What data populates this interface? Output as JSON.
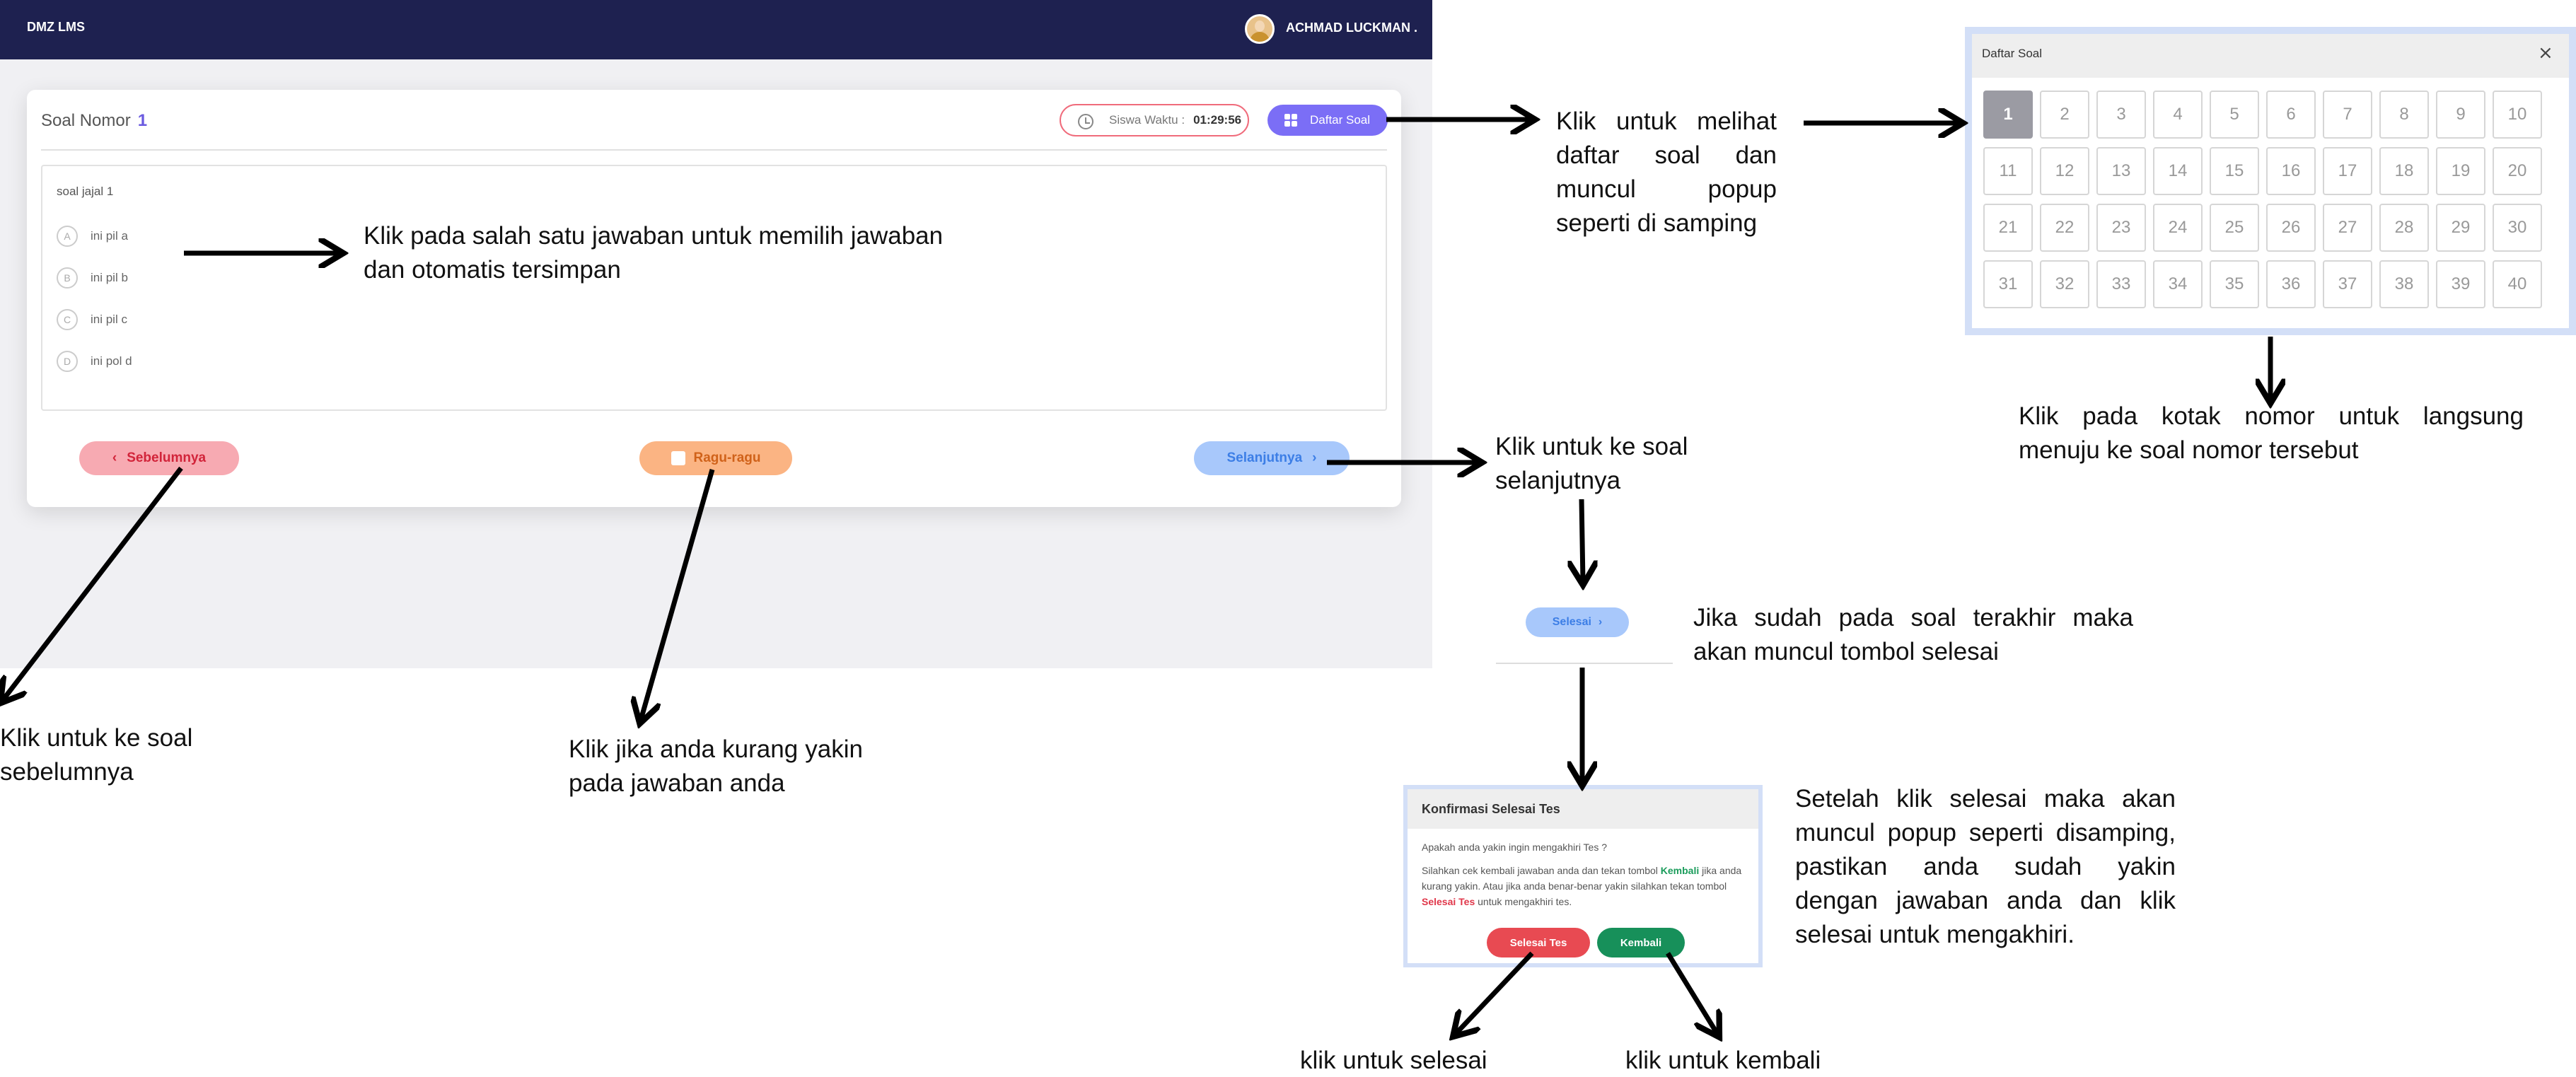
{
  "app": {
    "brand": "DMZ LMS",
    "username": "ACHMAD LUCKMAN ."
  },
  "exam": {
    "title_label": "Soal Nomor",
    "number": "1",
    "timer_label": "Siswa Waktu :",
    "timer_value": "01:29:56",
    "daftar_button": "Daftar Soal",
    "question": "soal jajal 1",
    "options": [
      {
        "letter": "A",
        "text": "ini pil a"
      },
      {
        "letter": "B",
        "text": "ini pil b"
      },
      {
        "letter": "C",
        "text": "ini pil c"
      },
      {
        "letter": "D",
        "text": "ini pol d"
      }
    ],
    "prev_button": "Sebelumnya",
    "ragu_button": "Ragu-ragu",
    "next_button": "Selanjutnya"
  },
  "daftar_popup": {
    "title": "Daftar Soal",
    "close": "×",
    "active": 1,
    "numbers": [
      "1",
      "2",
      "3",
      "4",
      "5",
      "6",
      "7",
      "8",
      "9",
      "10",
      "11",
      "12",
      "13",
      "14",
      "15",
      "16",
      "17",
      "18",
      "19",
      "20",
      "21",
      "22",
      "23",
      "24",
      "25",
      "26",
      "27",
      "28",
      "29",
      "30",
      "31",
      "32",
      "33",
      "34",
      "35",
      "36",
      "37",
      "38",
      "39",
      "40"
    ]
  },
  "selesai_button": "Selesai",
  "konfirmasi": {
    "title": "Konfirmasi Selesai Tes",
    "question": "Apakah anda yakin ingin mengakhiri Tes ?",
    "body_1": "Silahkan cek kembali jawaban anda dan tekan tombol ",
    "body_kembali": "Kembali",
    "body_2": " jika anda kurang yakin. Atau jika anda benar-benar yakin silahkan tekan tombol ",
    "body_selesai": "Selesai Tes",
    "body_3": " untuk mengakhiri tes.",
    "selesai_tes_button": "Selesai Tes",
    "kembali_button": "Kembali"
  },
  "notes": {
    "jawaban": "Klik pada salah satu jawaban untuk memilih jawaban dan otomatis tersimpan",
    "daftar": "Klik untuk melihat daftar soal dan muncul popup seperti di samping",
    "kotak": "Klik pada kotak nomor untuk langsung menuju ke soal nomor tersebut",
    "selanjutnya": "Klik untuk ke soal selanjutnya",
    "terakhir": "Jika sudah pada soal terakhir maka akan muncul tombol selesai",
    "konfirmasi": "Setelah klik selesai maka akan muncul popup seperti disamping, pastikan anda sudah yakin dengan jawaban anda dan klik selesai untuk mengakhiri.",
    "sebelumnya": "Klik untuk ke soal sebelumnya",
    "ragu": "Klik jika anda kurang yakin pada jawaban anda",
    "selesai": "klik untuk selesai",
    "kembali": "klik untuk kembali"
  }
}
